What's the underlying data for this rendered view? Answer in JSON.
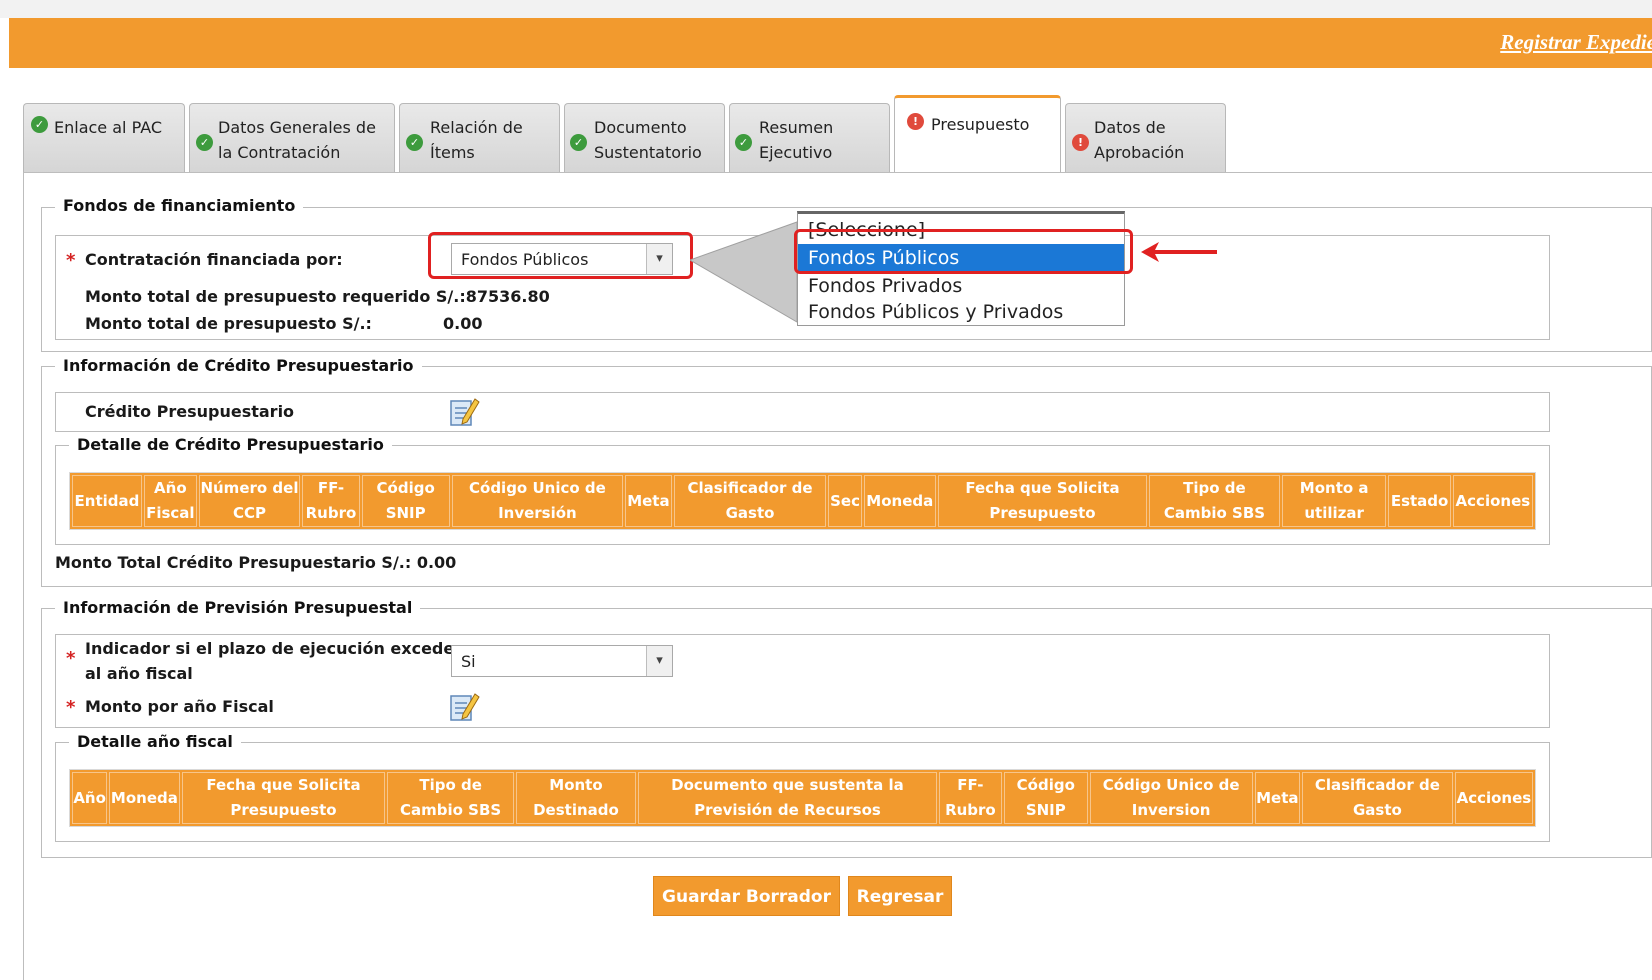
{
  "header": {
    "title": "Registrar Expedie"
  },
  "tabs": [
    {
      "label1": "Enlace al PAC",
      "label2": "",
      "status": "ok"
    },
    {
      "label1": "Datos Generales de",
      "label2": "la Contratación",
      "status": "ok"
    },
    {
      "label1": "Relación de",
      "label2": "Ítems",
      "status": "ok"
    },
    {
      "label1": "Documento",
      "label2": "Sustentatorio",
      "status": "ok"
    },
    {
      "label1": "Resumen",
      "label2": "Ejecutivo",
      "status": "ok"
    },
    {
      "label1": "Presupuesto",
      "label2": "",
      "status": "error",
      "active": true
    },
    {
      "label1": "Datos de",
      "label2": "Aprobación",
      "status": "error"
    }
  ],
  "fondos": {
    "legend": "Fondos de financiamiento",
    "financiada_label": "Contratación financiada por:",
    "financiada_value": "Fondos Públicos",
    "monto_requerido_label": "Monto total de presupuesto requerido S/.:87536.80",
    "monto_total_label": "Monto total de presupuesto S/.:",
    "monto_total_value": "0.00",
    "options": [
      "[Seleccione]",
      "Fondos Públicos",
      "Fondos Privados",
      "Fondos Públicos y Privados"
    ],
    "selected_option": "Fondos Públicos"
  },
  "credito": {
    "legend": "Información de Crédito Presupuestario",
    "credito_label": "Crédito Presupuestario",
    "detalle_legend": "Detalle de Crédito Presupuestario",
    "columns": [
      [
        "Entidad",
        ""
      ],
      [
        "Año",
        "Fiscal"
      ],
      [
        "Número del",
        "CCP"
      ],
      [
        "FF-",
        "Rubro"
      ],
      [
        "Código",
        "SNIP"
      ],
      [
        "Código Unico de",
        "Inversión"
      ],
      [
        "Meta",
        ""
      ],
      [
        "Clasificador de",
        "Gasto"
      ],
      [
        "Sec",
        ""
      ],
      [
        "Moneda",
        ""
      ],
      [
        "Fecha que Solicita",
        "Presupuesto"
      ],
      [
        "Tipo de",
        "Cambio SBS"
      ],
      [
        "Monto a",
        "utilizar"
      ],
      [
        "Estado",
        ""
      ],
      [
        "Acciones",
        ""
      ]
    ],
    "monto_total": "Monto Total Crédito Presupuestario S/.: 0.00"
  },
  "prevision": {
    "legend": "Información de Previsión Presupuestal",
    "indicador_label1": "Indicador si el plazo de ejecución excede",
    "indicador_label2": "al año fiscal",
    "indicador_value": "Si",
    "monto_anio_label": "Monto por año Fiscal",
    "detalle_legend": "Detalle año fiscal",
    "columns": [
      [
        "Año",
        ""
      ],
      [
        "Moneda",
        ""
      ],
      [
        "Fecha que Solicita",
        "Presupuesto"
      ],
      [
        "Tipo de",
        "Cambio SBS"
      ],
      [
        "Monto",
        "Destinado"
      ],
      [
        "Documento que sustenta la",
        "Previsión de Recursos"
      ],
      [
        "FF-",
        "Rubro"
      ],
      [
        "Código",
        "SNIP"
      ],
      [
        "Código Unico de",
        "Inversion"
      ],
      [
        "Meta",
        ""
      ],
      [
        "Clasificador de",
        "Gasto"
      ],
      [
        "Acciones",
        ""
      ]
    ]
  },
  "buttons": {
    "guardar": "Guardar Borrador",
    "regresar": "Regresar"
  },
  "colors": {
    "accent": "#f29a2e",
    "ok": "#3d9b3d",
    "error": "#e04a3c",
    "highlight": "#1b78d6",
    "annotation": "#e02121"
  }
}
